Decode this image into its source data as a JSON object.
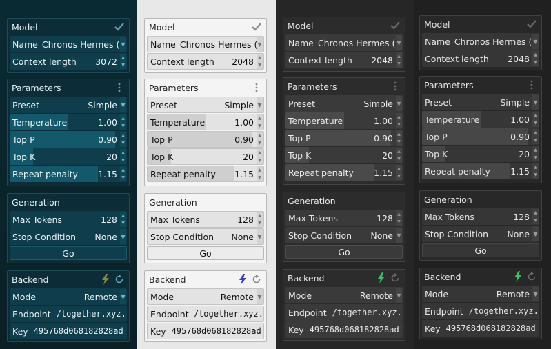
{
  "themes": [
    {
      "id": "teal",
      "accent": "#5fa8b5",
      "bolt_color": "#8a8a3a"
    },
    {
      "id": "light",
      "accent": "#888888",
      "bolt_color": "#3a3acc"
    },
    {
      "id": "dark",
      "accent": "#6a6a6a",
      "bolt_color": "#3fbf6a"
    },
    {
      "id": "darker",
      "accent": "#6a6a6a",
      "bolt_color": "#3fbf6a"
    }
  ],
  "model": {
    "title": "Model",
    "name_label": "Name",
    "name_value": "Chronos Hermes (...",
    "context_label": "Context length",
    "context_values": [
      "3072",
      "2048",
      "2048",
      "2048"
    ]
  },
  "parameters": {
    "title": "Parameters",
    "preset_label": "Preset",
    "preset_value": "Simple",
    "temperature_label": "Temperature",
    "temperature_value": "1.00",
    "temperature_level": 0.5,
    "top_p_label": "Top P",
    "top_p_value": "0.90",
    "top_p_level": 0.9,
    "top_k_label": "Top K",
    "top_k_value": "20",
    "top_k_level": 0.2,
    "repeat_label": "Repeat penalty",
    "repeat_value": "1.15",
    "repeat_level": 0.75
  },
  "generation": {
    "title": "Generation",
    "max_tokens_label": "Max Tokens",
    "max_tokens_value": "128",
    "stop_label": "Stop Condition",
    "stop_value": "None",
    "go_label": "Go"
  },
  "backend": {
    "title": "Backend",
    "mode_label": "Mode",
    "mode_value": "Remote",
    "endpoint_label": "Endpoint",
    "endpoint_value": ".together.xyz/",
    "key_label": "Key",
    "key_value": "495768d068182828ad"
  },
  "icons": {
    "model_status": "check-icon",
    "params_menu": "kebab-menu-icon",
    "backend_connect": "bolt-icon",
    "backend_refresh": "refresh-icon"
  }
}
